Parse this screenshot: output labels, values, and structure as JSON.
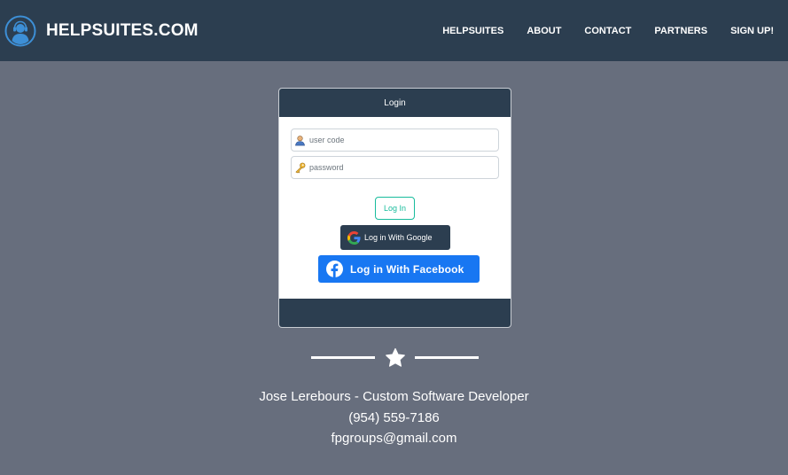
{
  "navbar": {
    "brand": "HELPSUITES.COM",
    "logo_icon": "headset-agent-icon",
    "links": [
      "HELPSUITES",
      "ABOUT",
      "CONTACT",
      "PARTNERS",
      "SIGN UP!"
    ]
  },
  "login": {
    "title": "Login",
    "user_placeholder": "user code",
    "password_placeholder": "password",
    "login_label": "Log In",
    "google_label": "Log in With Google",
    "facebook_label": "Log in With Facebook"
  },
  "contact": {
    "name": "Jose Lerebours - Custom Software Developer",
    "phone": "(954) 559-7186",
    "email": "fpgroups@gmail.com"
  },
  "colors": {
    "navbar": "#2c3e50",
    "background": "#676e7d",
    "accent": "#18bc9c",
    "facebook": "#1877f2"
  }
}
